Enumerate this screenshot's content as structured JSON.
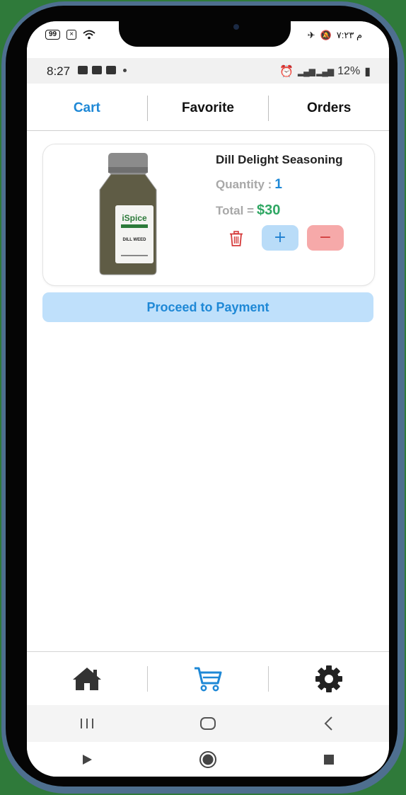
{
  "outer_status": {
    "battery": "99",
    "right_text": "م ٧:٢٣"
  },
  "status_bar": {
    "time": "8:27",
    "battery": "12%"
  },
  "tabs": [
    {
      "label": "Cart",
      "active": true
    },
    {
      "label": "Favorite",
      "active": false
    },
    {
      "label": "Orders",
      "active": false
    }
  ],
  "cart_item": {
    "name": "Dill Delight Seasoning",
    "quantity_label": "Quantity :",
    "quantity": "1",
    "total_label": "Total =",
    "total": "$30",
    "image_brand": "iSpice",
    "image_label": "DILL WEED"
  },
  "buttons": {
    "plus": "+",
    "minus": "−",
    "proceed": "Proceed to Payment"
  },
  "bottom_nav": [
    {
      "icon": "home-icon"
    },
    {
      "icon": "cart-icon",
      "active": true
    },
    {
      "icon": "gear-icon"
    }
  ],
  "colors": {
    "accent": "#1e88d6",
    "total_green": "#2fa763",
    "minus_red": "#f6a9a9",
    "plus_blue": "#b9dcf8"
  }
}
